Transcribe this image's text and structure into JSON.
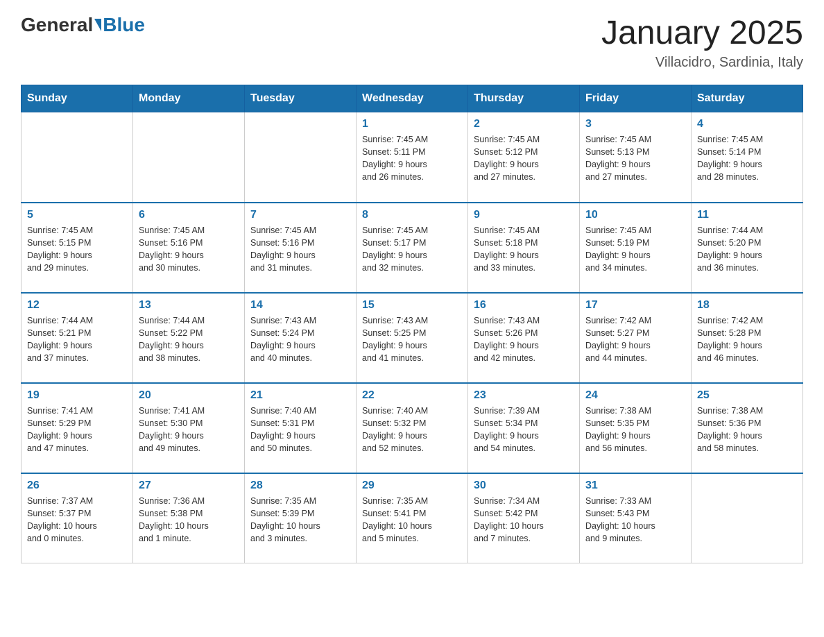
{
  "header": {
    "logo_general": "General",
    "logo_blue": "Blue",
    "month_title": "January 2025",
    "location": "Villacidro, Sardinia, Italy"
  },
  "weekdays": [
    "Sunday",
    "Monday",
    "Tuesday",
    "Wednesday",
    "Thursday",
    "Friday",
    "Saturday"
  ],
  "weeks": [
    [
      {
        "day": "",
        "info": ""
      },
      {
        "day": "",
        "info": ""
      },
      {
        "day": "",
        "info": ""
      },
      {
        "day": "1",
        "info": "Sunrise: 7:45 AM\nSunset: 5:11 PM\nDaylight: 9 hours\nand 26 minutes."
      },
      {
        "day": "2",
        "info": "Sunrise: 7:45 AM\nSunset: 5:12 PM\nDaylight: 9 hours\nand 27 minutes."
      },
      {
        "day": "3",
        "info": "Sunrise: 7:45 AM\nSunset: 5:13 PM\nDaylight: 9 hours\nand 27 minutes."
      },
      {
        "day": "4",
        "info": "Sunrise: 7:45 AM\nSunset: 5:14 PM\nDaylight: 9 hours\nand 28 minutes."
      }
    ],
    [
      {
        "day": "5",
        "info": "Sunrise: 7:45 AM\nSunset: 5:15 PM\nDaylight: 9 hours\nand 29 minutes."
      },
      {
        "day": "6",
        "info": "Sunrise: 7:45 AM\nSunset: 5:16 PM\nDaylight: 9 hours\nand 30 minutes."
      },
      {
        "day": "7",
        "info": "Sunrise: 7:45 AM\nSunset: 5:16 PM\nDaylight: 9 hours\nand 31 minutes."
      },
      {
        "day": "8",
        "info": "Sunrise: 7:45 AM\nSunset: 5:17 PM\nDaylight: 9 hours\nand 32 minutes."
      },
      {
        "day": "9",
        "info": "Sunrise: 7:45 AM\nSunset: 5:18 PM\nDaylight: 9 hours\nand 33 minutes."
      },
      {
        "day": "10",
        "info": "Sunrise: 7:45 AM\nSunset: 5:19 PM\nDaylight: 9 hours\nand 34 minutes."
      },
      {
        "day": "11",
        "info": "Sunrise: 7:44 AM\nSunset: 5:20 PM\nDaylight: 9 hours\nand 36 minutes."
      }
    ],
    [
      {
        "day": "12",
        "info": "Sunrise: 7:44 AM\nSunset: 5:21 PM\nDaylight: 9 hours\nand 37 minutes."
      },
      {
        "day": "13",
        "info": "Sunrise: 7:44 AM\nSunset: 5:22 PM\nDaylight: 9 hours\nand 38 minutes."
      },
      {
        "day": "14",
        "info": "Sunrise: 7:43 AM\nSunset: 5:24 PM\nDaylight: 9 hours\nand 40 minutes."
      },
      {
        "day": "15",
        "info": "Sunrise: 7:43 AM\nSunset: 5:25 PM\nDaylight: 9 hours\nand 41 minutes."
      },
      {
        "day": "16",
        "info": "Sunrise: 7:43 AM\nSunset: 5:26 PM\nDaylight: 9 hours\nand 42 minutes."
      },
      {
        "day": "17",
        "info": "Sunrise: 7:42 AM\nSunset: 5:27 PM\nDaylight: 9 hours\nand 44 minutes."
      },
      {
        "day": "18",
        "info": "Sunrise: 7:42 AM\nSunset: 5:28 PM\nDaylight: 9 hours\nand 46 minutes."
      }
    ],
    [
      {
        "day": "19",
        "info": "Sunrise: 7:41 AM\nSunset: 5:29 PM\nDaylight: 9 hours\nand 47 minutes."
      },
      {
        "day": "20",
        "info": "Sunrise: 7:41 AM\nSunset: 5:30 PM\nDaylight: 9 hours\nand 49 minutes."
      },
      {
        "day": "21",
        "info": "Sunrise: 7:40 AM\nSunset: 5:31 PM\nDaylight: 9 hours\nand 50 minutes."
      },
      {
        "day": "22",
        "info": "Sunrise: 7:40 AM\nSunset: 5:32 PM\nDaylight: 9 hours\nand 52 minutes."
      },
      {
        "day": "23",
        "info": "Sunrise: 7:39 AM\nSunset: 5:34 PM\nDaylight: 9 hours\nand 54 minutes."
      },
      {
        "day": "24",
        "info": "Sunrise: 7:38 AM\nSunset: 5:35 PM\nDaylight: 9 hours\nand 56 minutes."
      },
      {
        "day": "25",
        "info": "Sunrise: 7:38 AM\nSunset: 5:36 PM\nDaylight: 9 hours\nand 58 minutes."
      }
    ],
    [
      {
        "day": "26",
        "info": "Sunrise: 7:37 AM\nSunset: 5:37 PM\nDaylight: 10 hours\nand 0 minutes."
      },
      {
        "day": "27",
        "info": "Sunrise: 7:36 AM\nSunset: 5:38 PM\nDaylight: 10 hours\nand 1 minute."
      },
      {
        "day": "28",
        "info": "Sunrise: 7:35 AM\nSunset: 5:39 PM\nDaylight: 10 hours\nand 3 minutes."
      },
      {
        "day": "29",
        "info": "Sunrise: 7:35 AM\nSunset: 5:41 PM\nDaylight: 10 hours\nand 5 minutes."
      },
      {
        "day": "30",
        "info": "Sunrise: 7:34 AM\nSunset: 5:42 PM\nDaylight: 10 hours\nand 7 minutes."
      },
      {
        "day": "31",
        "info": "Sunrise: 7:33 AM\nSunset: 5:43 PM\nDaylight: 10 hours\nand 9 minutes."
      },
      {
        "day": "",
        "info": ""
      }
    ]
  ]
}
